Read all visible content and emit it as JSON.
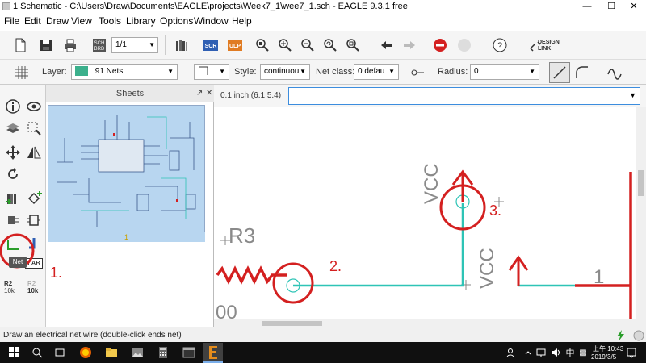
{
  "window": {
    "title": "1 Schematic - C:\\Users\\Draw\\Documents\\EAGLE\\projects\\Week7_1\\wee7_1.sch - EAGLE 9.3.1 free",
    "minimize": "—",
    "maximize": "☐",
    "close": "✕"
  },
  "menu": [
    "File",
    "Edit",
    "Draw",
    "View",
    "Tools",
    "Library",
    "Options",
    "Window",
    "Help"
  ],
  "toolbar": {
    "page_value": "1/1",
    "sch_label": "SCH",
    "brd_label": "BRD",
    "scr_label": "SCR",
    "ulp_label": "ULP",
    "design_link_1": "DESIGN",
    "design_link_2": "LINK",
    "help_label": "?"
  },
  "params": {
    "layer_label": "Layer:",
    "layer_value": "91 Nets",
    "layer_color": "#3cb08c",
    "style_label": "Style:",
    "style_value": "continuou",
    "netclass_label": "Net class:",
    "netclass_value": "0 defau",
    "radius_label": "Radius:",
    "radius_value": "0"
  },
  "leftbar": {
    "net_tooltip": "Net",
    "label_btn": "LAB",
    "r2_name": "R2",
    "r2_value": "10k",
    "r2b_name": "R2",
    "r2b_value": "10k"
  },
  "sheets": {
    "title": "Sheets",
    "sheet_number": "1"
  },
  "command": {
    "coord": "0.1 inch (6.1 5.4)",
    "input_value": ""
  },
  "canvas": {
    "r3_label": "R3",
    "vcc_top": "VCC",
    "vcc_bottom": "VCC",
    "pin_one": "1",
    "partial_text": "00",
    "net_color": "#2ec4b6",
    "wire_color": "#d42020",
    "annotations": [
      "1.",
      "2.",
      "3."
    ]
  },
  "status": {
    "text": "Draw an electrical net wire (double-click ends net)"
  },
  "taskbar": {
    "ime_1": "上午",
    "time": "10:43",
    "date": "2019/3/5",
    "ime_lang": "中"
  }
}
